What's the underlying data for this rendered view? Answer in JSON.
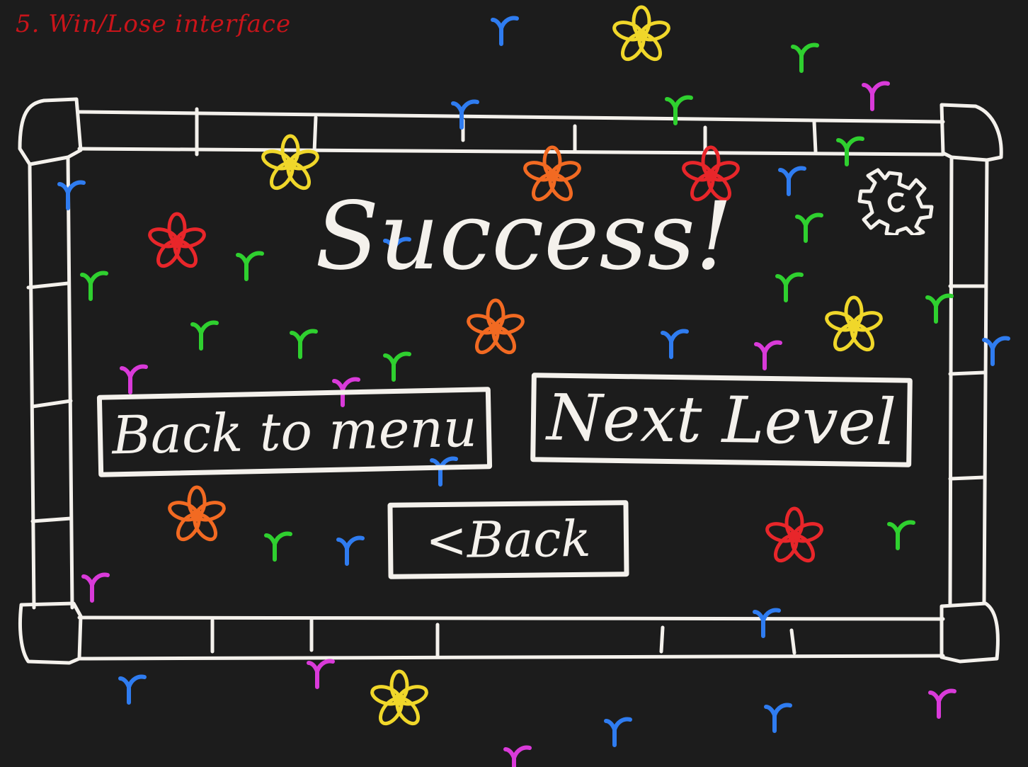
{
  "screen": {
    "annotation": "5. Win/Lose interface",
    "headline": "Success!"
  },
  "buttons": {
    "back_to_menu": "Back to menu",
    "next_level": "Next Level",
    "back": "<Back"
  },
  "icons": {
    "settings": "gear-icon",
    "decorations": "flower-confetti"
  },
  "colors": {
    "background": "#1c1c1c",
    "chalk": "#f4f1ec",
    "annotation": "#c9141a",
    "confetti": [
      "#f0d72a",
      "#f26a22",
      "#e8262a",
      "#2f7cf0",
      "#2fd02f",
      "#d93ad9"
    ]
  }
}
